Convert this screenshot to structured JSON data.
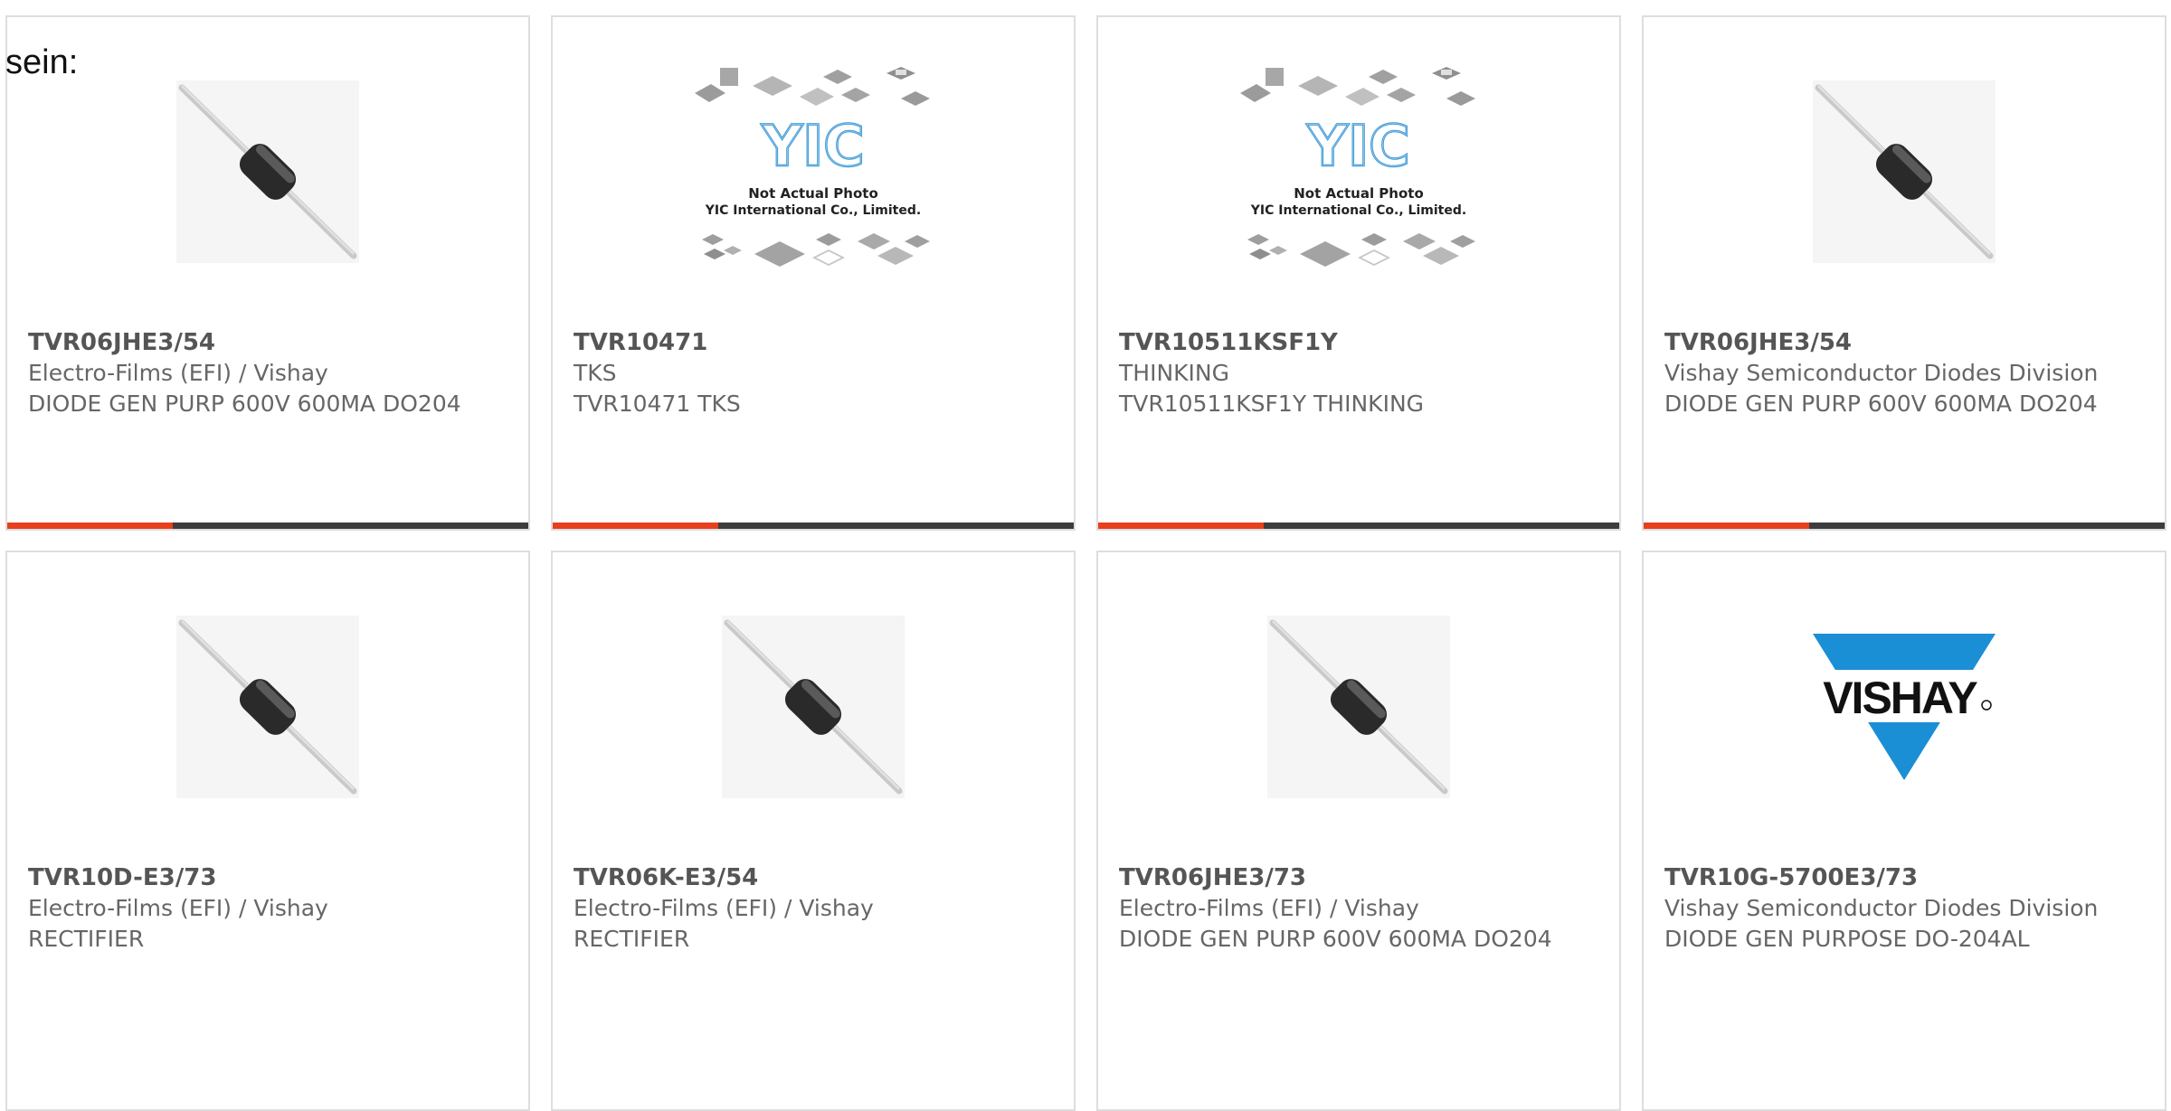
{
  "lead_text": "sein:",
  "colors": {
    "accent": "#e8401c",
    "bar": "#3d3d3d",
    "card_border": "#dedede",
    "text_muted": "#666666",
    "vishay_blue": "#1a8fd6"
  },
  "placeholder_image": {
    "line1": "Not Actual Photo",
    "line2": "YIC International Co., Limited."
  },
  "vishay_logo_text": "VISHAY",
  "products": [
    {
      "part": "TVR06JHE3/54",
      "maker": "Electro-Films (EFI) / Vishay",
      "desc": "DIODE GEN PURP 600V 600MA DO204",
      "image": "diode-image"
    },
    {
      "part": "TVR10471",
      "maker": "TKS",
      "desc": "TVR10471 TKS",
      "image": "not-actual-photo-image"
    },
    {
      "part": "TVR10511KSF1Y",
      "maker": "THINKING",
      "desc": "TVR10511KSF1Y THINKING",
      "image": "not-actual-photo-image"
    },
    {
      "part": "TVR06JHE3/54",
      "maker": "Vishay Semiconductor Diodes Division",
      "desc": "DIODE GEN PURP 600V 600MA DO204",
      "image": "diode-image"
    },
    {
      "part": "TVR10D-E3/73",
      "maker": "Electro-Films (EFI) / Vishay",
      "desc": "RECTIFIER",
      "image": "diode-image"
    },
    {
      "part": "TVR06K-E3/54",
      "maker": "Electro-Films (EFI) / Vishay",
      "desc": "RECTIFIER",
      "image": "diode-image"
    },
    {
      "part": "TVR06JHE3/73",
      "maker": "Electro-Films (EFI) / Vishay",
      "desc": "DIODE GEN PURP 600V 600MA DO204",
      "image": "diode-image"
    },
    {
      "part": "TVR10G-5700E3/73",
      "maker": "Vishay Semiconductor Diodes Division",
      "desc": "DIODE GEN PURPOSE DO-204AL",
      "image": "vishay-logo-image"
    }
  ]
}
